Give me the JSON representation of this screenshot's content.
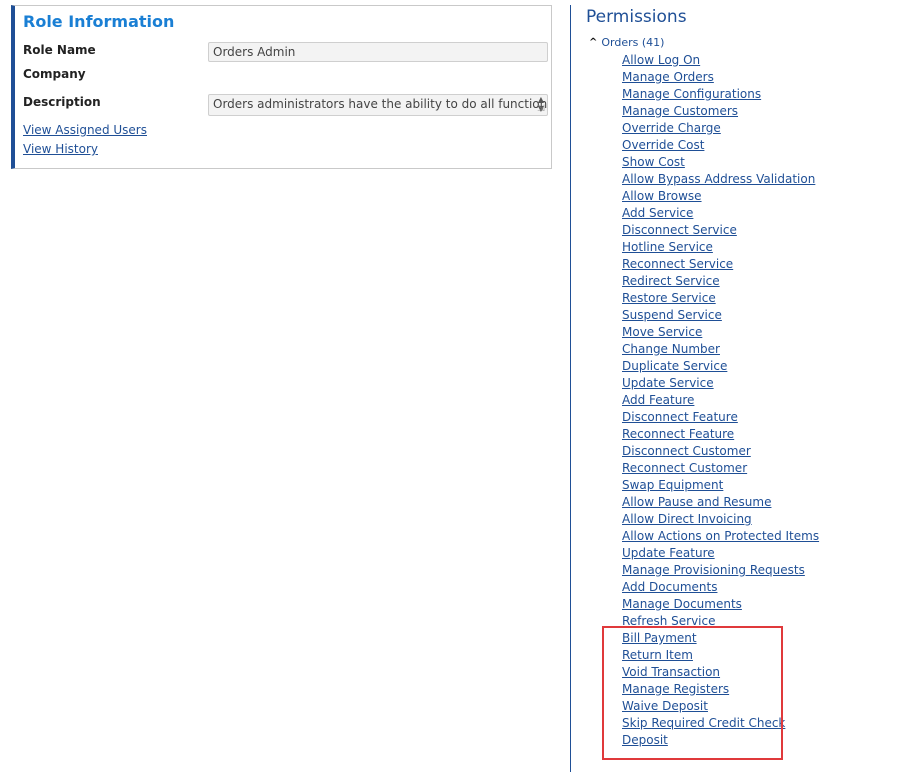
{
  "role_info": {
    "title": "Role Information",
    "role_name_label": "Role Name",
    "role_name_value": "Orders Admin",
    "company_label": "Company",
    "description_label": "Description",
    "description_value": "Orders administrators have the ability to do all functions",
    "links": [
      "View Assigned Users",
      "View History"
    ]
  },
  "permissions": {
    "title": "Permissions",
    "group_label": "Orders (41)",
    "items": [
      "Allow Log On",
      "Manage Orders",
      "Manage Configurations",
      "Manage Customers",
      "Override Charge",
      "Override Cost",
      "Show Cost",
      "Allow Bypass Address Validation",
      "Allow Browse",
      "Add Service",
      "Disconnect Service",
      "Hotline Service",
      "Reconnect Service",
      "Redirect Service",
      "Restore Service",
      "Suspend Service",
      "Move Service",
      "Change Number",
      "Duplicate Service",
      "Update Service",
      "Add Feature",
      "Disconnect Feature",
      "Reconnect Feature",
      "Disconnect Customer",
      "Reconnect Customer",
      "Swap Equipment",
      "Allow Pause and Resume",
      "Allow Direct Invoicing",
      "Allow Actions on Protected Items",
      "Update Feature",
      "Manage Provisioning Requests",
      "Add Documents",
      "Manage Documents",
      "Refresh Service",
      "Bill Payment",
      "Return Item",
      "Void Transaction",
      "Manage Registers",
      "Waive Deposit",
      "Skip Required Credit Check",
      "Deposit"
    ]
  },
  "colors": {
    "accent": "#1a7fd4",
    "link": "#1f4f96",
    "highlight": "#e0393b"
  }
}
